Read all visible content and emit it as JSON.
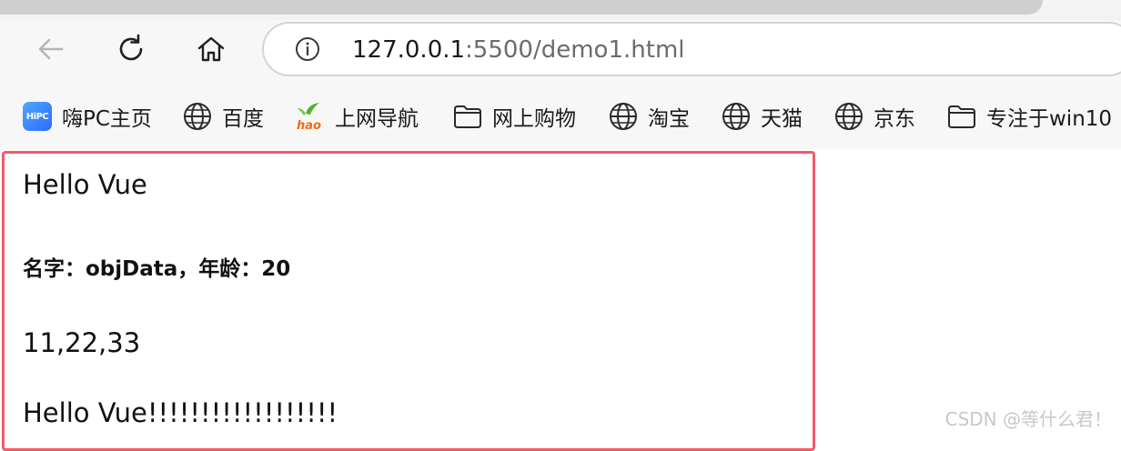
{
  "browser": {
    "back_icon": "arrow-left-icon",
    "reload_icon": "reload-icon",
    "home_icon": "home-icon",
    "info_icon": "info-icon",
    "url_host": "127.0.0.1",
    "url_path": ":5500/demo1.html"
  },
  "bookmarks": [
    {
      "label": "嗨PC主页",
      "icon": "hipc-logo-icon",
      "badge": "HiPC"
    },
    {
      "label": "百度",
      "icon": "globe-icon"
    },
    {
      "label": "上网导航",
      "icon": "hao-logo-icon"
    },
    {
      "label": "网上购物",
      "icon": "folder-icon"
    },
    {
      "label": "淘宝",
      "icon": "globe-icon"
    },
    {
      "label": "天猫",
      "icon": "globe-icon"
    },
    {
      "label": "京东",
      "icon": "globe-icon"
    },
    {
      "label": "专注于win10",
      "icon": "folder-icon"
    }
  ],
  "page": {
    "message": "Hello Vue",
    "info": "名字：objData，年龄：20",
    "array": "11,22,33",
    "message_excited": "Hello Vue!!!!!!!!!!!!!!!!!!"
  },
  "colors": {
    "highlight_border": "#ef5b6b",
    "toolbar_bg": "#f7f7f7"
  },
  "watermark": "CSDN @等什么君！"
}
